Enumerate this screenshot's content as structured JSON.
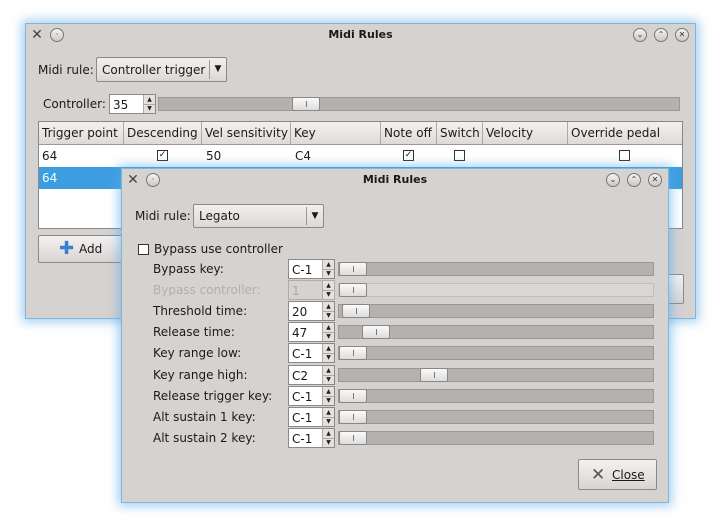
{
  "main_window": {
    "title": "Midi Rules",
    "midi_rule_label": "Midi rule:",
    "midi_rule_value": "Controller trigger",
    "controller_label": "Controller:",
    "controller_value": "35",
    "controller_slider": 0.27,
    "table": {
      "columns": [
        "Trigger point",
        "Descending",
        "Vel sensitivity",
        "Key",
        "Note off",
        "Switch",
        "Velocity",
        "Override pedal"
      ],
      "rows": [
        {
          "trigger_point": "64",
          "descending": true,
          "vel_sensitivity": "50",
          "key": "C4",
          "note_off": true,
          "switch": false,
          "velocity": "",
          "override_pedal": false
        },
        {
          "trigger_point": "64",
          "selected": true
        }
      ]
    },
    "add_button": "Add",
    "add_icon": "plus-icon"
  },
  "dialog": {
    "title": "Midi Rules",
    "midi_rule_label": "Midi rule:",
    "midi_rule_value": "Legato",
    "bypass_checkbox_label": "Bypass use controller",
    "bypass_checked": false,
    "fields": [
      {
        "label": "Bypass key:",
        "value": "C-1",
        "slider": 0.0,
        "disabled": false
      },
      {
        "label": "Bypass controller:",
        "value": "1",
        "slider": 0.0,
        "disabled": true
      },
      {
        "label": "Threshold time:",
        "value": "20",
        "slider": 0.01,
        "disabled": false
      },
      {
        "label": "Release time:",
        "value": "47",
        "slider": 0.08,
        "disabled": false
      },
      {
        "label": "Key range low:",
        "value": "C-1",
        "slider": 0.0,
        "disabled": false
      },
      {
        "label": "Key range high:",
        "value": "C2",
        "slider": 0.28,
        "disabled": false
      },
      {
        "label": "Release trigger key:",
        "value": "C-1",
        "slider": 0.0,
        "disabled": false
      },
      {
        "label": "Alt sustain 1 key:",
        "value": "C-1",
        "slider": 0.0,
        "disabled": false
      },
      {
        "label": "Alt sustain 2 key:",
        "value": "C-1",
        "slider": 0.0,
        "disabled": false
      }
    ],
    "close_button": "Close",
    "close_icon": "close-x-icon"
  },
  "colors": {
    "selection": "#3c9ee0",
    "window_bg": "#d6d2d0",
    "glow": "#5aaae6"
  }
}
